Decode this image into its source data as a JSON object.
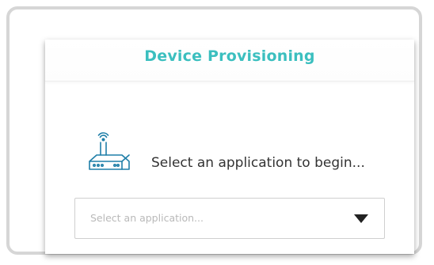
{
  "header": {
    "title": "Device Provisioning"
  },
  "prompt": {
    "text": "Select an application to begin...",
    "icon": "router-icon"
  },
  "application_select": {
    "placeholder": "Select an application...",
    "icon": "caret-down-icon"
  },
  "colors": {
    "accent": "#3bbfbf",
    "icon_stroke": "#1f7fa8",
    "frame_border": "#d6d6d6"
  }
}
